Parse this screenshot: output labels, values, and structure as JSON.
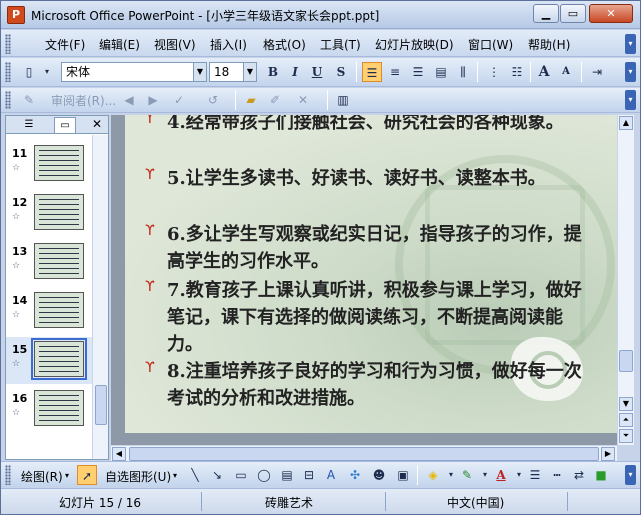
{
  "window": {
    "title": "Microsoft Office PowerPoint - [小学三年级语文家长会ppt.ppt]",
    "app_icon": "powerpoint-icon",
    "controls": [
      "minimize",
      "maximize",
      "close"
    ]
  },
  "menu": {
    "items": [
      "文件(F)",
      "编辑(E)",
      "视图(V)",
      "插入(I)",
      "格式(O)",
      "工具(T)",
      "幻灯片放映(D)",
      "窗口(W)",
      "帮助(H)"
    ]
  },
  "format_toolbar": {
    "font_name": "宋体",
    "font_size": "18",
    "bold": "B",
    "italic": "I",
    "underline": "U",
    "shadow": "S",
    "grow_font": "A",
    "shrink_font": "A"
  },
  "review_toolbar": {
    "reviewer_label": "审阅者(R)..."
  },
  "slide_pane": {
    "tabs": [
      "outline-tab",
      "slides-tab"
    ],
    "thumbnails": [
      {
        "number": "11"
      },
      {
        "number": "12"
      },
      {
        "number": "13"
      },
      {
        "number": "14"
      },
      {
        "number": "15",
        "selected": true
      },
      {
        "number": "16"
      }
    ]
  },
  "slide": {
    "bullets": [
      {
        "num": "4.",
        "text": "经常带孩子们接触社会、研究社会的各种现象。"
      },
      {
        "num": "5.",
        "text": "让学生多读书、好读书、读好书、读整本书。"
      },
      {
        "num": "6.",
        "text": "多让学生写观察或纪实日记，指导孩子的习作，提高学生的习作水平。"
      },
      {
        "num": "7.",
        "text": "教育孩子上课认真听讲，积极参与课上学习，做好笔记，课下有选择的做阅读练习，不断提高阅读能力。"
      },
      {
        "num": "8.",
        "text": "注重培养孩子良好的学习和行为习惯，做好每一次考试的分析和改进措施。"
      }
    ],
    "bullet_glyph": "ϒ",
    "bullet_color": "#c22d1a"
  },
  "drawing_toolbar": {
    "draw_label": "绘图(R)",
    "autoshapes_label": "自选图形(U)"
  },
  "status": {
    "slide_position": "幻灯片 15 / 16",
    "design": "砖雕艺术",
    "language": "中文(中国)"
  }
}
